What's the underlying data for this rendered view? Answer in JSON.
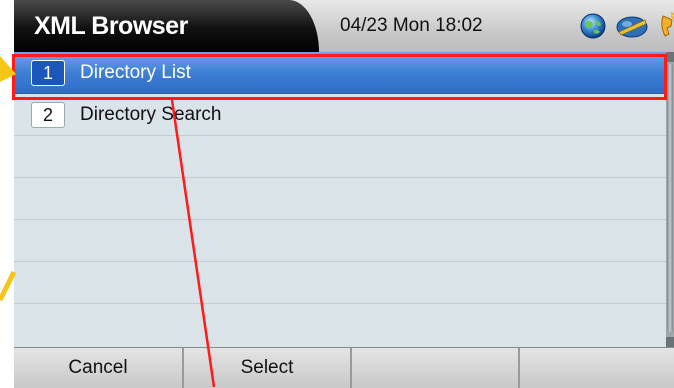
{
  "header": {
    "title": "XML Browser",
    "datetime": "04/23 Mon 18:02",
    "icons": [
      "globe-icon",
      "network-icon",
      "phone-handset-icon"
    ]
  },
  "list": {
    "items": [
      {
        "number": "1",
        "label": "Directory List",
        "selected": true
      },
      {
        "number": "2",
        "label": "Directory Search",
        "selected": false
      }
    ]
  },
  "softkeys": [
    "Cancel",
    "Select",
    "",
    ""
  ],
  "colors": {
    "selection": "#3f7fd6",
    "list_background": "#d9e3e8",
    "annotation_red": "#ff1a1a",
    "annotation_yellow": "#f5c518"
  }
}
